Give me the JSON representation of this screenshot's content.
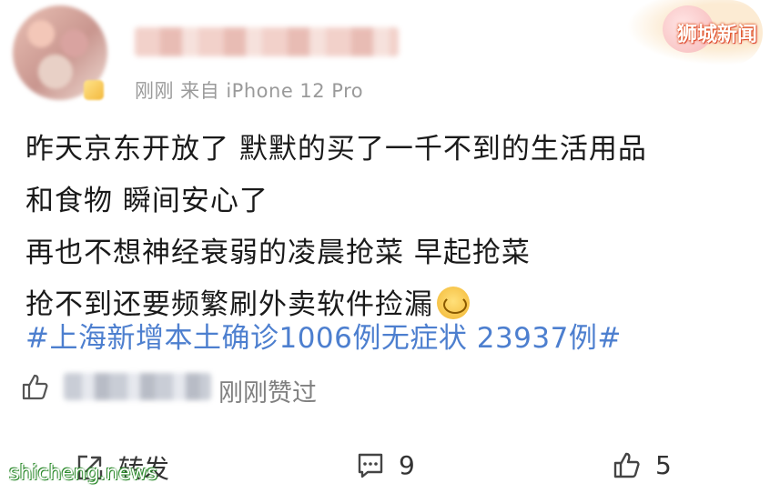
{
  "header": {
    "meta": "刚刚  来自 iPhone 12 Pro",
    "watermark": "狮城新闻"
  },
  "post": {
    "lines": [
      "昨天京东开放了 默默的买了一千不到的生活用品",
      "和食物 瞬间安心了",
      "再也不想神经衰弱的凌晨抢菜 早起抢菜",
      "抢不到还要频繁刷外卖软件捡漏"
    ],
    "topic": "#上海新增本土确诊1006例无症状 23937例#"
  },
  "likes": {
    "liked_text": "刚刚赞过"
  },
  "actions": {
    "repost_label": "转发",
    "comment_count": "9",
    "like_count": "5"
  },
  "watermark_bottom": "shicheng.news",
  "icons": {
    "thumb": "thumb-up-icon",
    "repost": "repost-icon",
    "comment": "comment-icon",
    "emoji": "emoji-icon"
  },
  "colors": {
    "topic": "#4d7fcf",
    "meta": "#9a9a9a"
  }
}
